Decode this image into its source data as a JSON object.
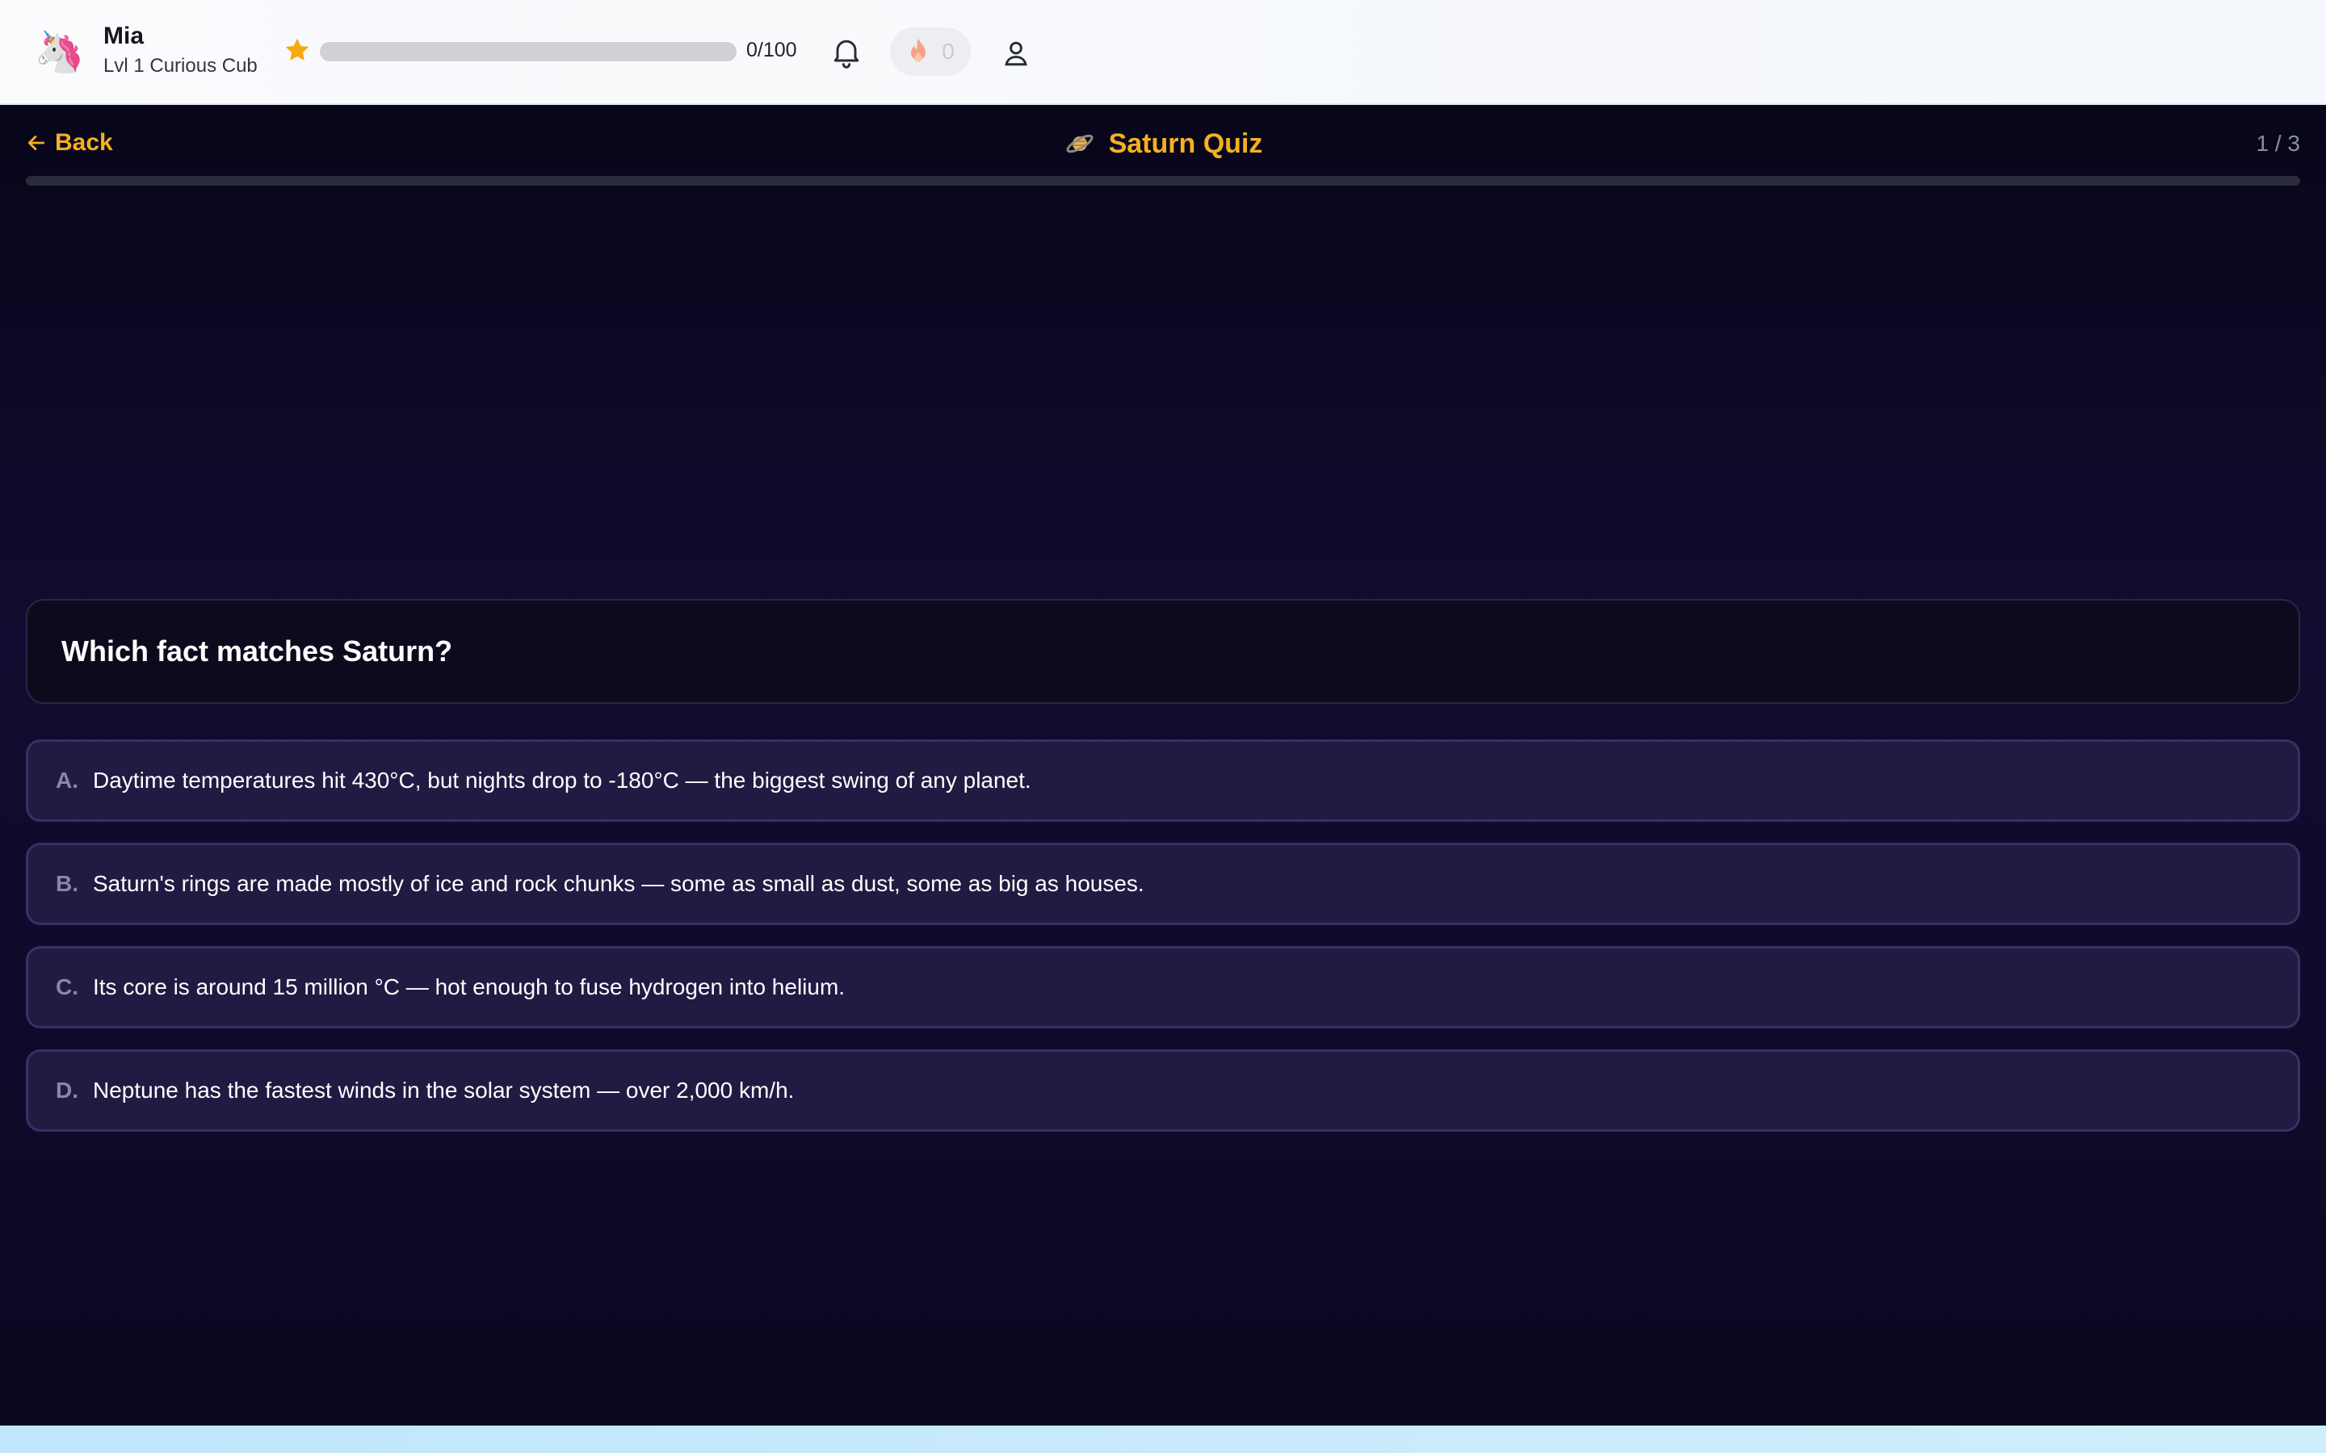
{
  "header": {
    "avatar_emoji": "🦄",
    "user_name": "Mia",
    "level_label": "Lvl 1 Curious Cub",
    "xp_text": "0/100",
    "xp_fraction": 0,
    "streak_count": "0",
    "colors": {
      "accent": "#f6a90f",
      "track": "#cfd1d5"
    },
    "icons": {
      "star": "star-icon",
      "bell": "bell-icon",
      "flame": "flame-icon",
      "profile": "user-icon"
    }
  },
  "quiz": {
    "back_label": "Back",
    "title": "Saturn Quiz",
    "planet_icon": "planet-ringed-icon",
    "counter": "1 / 3",
    "question_progress_fraction": 0,
    "question": "Which fact matches Saturn?",
    "options": [
      {
        "letter": "A.",
        "text": "Daytime temperatures hit 430°C, but nights drop to -180°C — the biggest swing of any planet."
      },
      {
        "letter": "B.",
        "text": "Saturn's rings are made mostly of ice and rock chunks — some as small as dust, some as big as houses."
      },
      {
        "letter": "C.",
        "text": "Its core is around 15 million °C — hot enough to fuse hydrogen into helium."
      },
      {
        "letter": "D.",
        "text": "Neptune has the fastest winds in the solar system — over 2,000 km/h."
      }
    ],
    "colors": {
      "accent": "#f5b021",
      "background": "#0b0820",
      "option_bg": "#221a42",
      "option_border": "#3a2f66"
    }
  }
}
